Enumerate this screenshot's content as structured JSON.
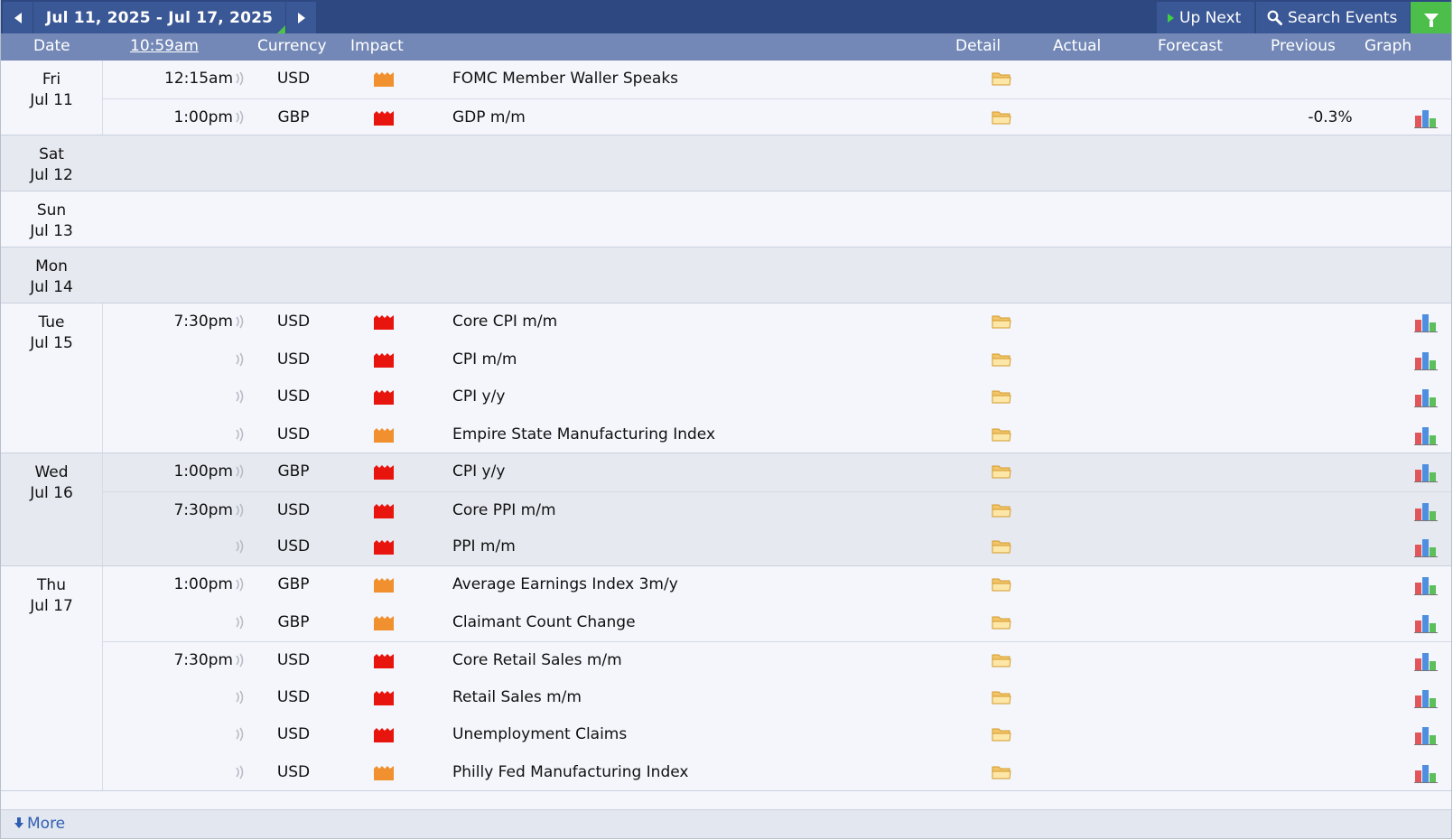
{
  "toolbar": {
    "date_range": "Jul 11, 2025 - Jul 17, 2025",
    "up_next": "Up Next",
    "search": "Search Events"
  },
  "columns": {
    "date": "Date",
    "time": "10:59am",
    "currency": "Currency",
    "impact": "Impact",
    "detail": "Detail",
    "actual": "Actual",
    "forecast": "Forecast",
    "previous": "Previous",
    "graph": "Graph"
  },
  "impact_colors": {
    "high": "#e8150e",
    "medium": "#f0902e"
  },
  "days": [
    {
      "weekday": "Fri",
      "date": "Jul 11",
      "events": [
        {
          "time": "12:15am",
          "currency": "USD",
          "impact": "medium",
          "name": "FOMC Member Waller Speaks",
          "previous": "",
          "graph": false,
          "sep": false
        },
        {
          "time": "1:00pm",
          "currency": "GBP",
          "impact": "high",
          "name": "GDP m/m",
          "previous": "-0.3%",
          "graph": true,
          "sep": true
        }
      ]
    },
    {
      "weekday": "Sat",
      "date": "Jul 12",
      "events": []
    },
    {
      "weekday": "Sun",
      "date": "Jul 13",
      "events": []
    },
    {
      "weekday": "Mon",
      "date": "Jul 14",
      "events": []
    },
    {
      "weekday": "Tue",
      "date": "Jul 15",
      "events": [
        {
          "time": "7:30pm",
          "currency": "USD",
          "impact": "high",
          "name": "Core CPI m/m",
          "previous": "",
          "graph": true,
          "sep": false
        },
        {
          "time": "",
          "currency": "USD",
          "impact": "high",
          "name": "CPI m/m",
          "previous": "",
          "graph": true,
          "sep": false
        },
        {
          "time": "",
          "currency": "USD",
          "impact": "high",
          "name": "CPI y/y",
          "previous": "",
          "graph": true,
          "sep": false
        },
        {
          "time": "",
          "currency": "USD",
          "impact": "medium",
          "name": "Empire State Manufacturing Index",
          "previous": "",
          "graph": true,
          "sep": false
        }
      ]
    },
    {
      "weekday": "Wed",
      "date": "Jul 16",
      "events": [
        {
          "time": "1:00pm",
          "currency": "GBP",
          "impact": "high",
          "name": "CPI y/y",
          "previous": "",
          "graph": true,
          "sep": false
        },
        {
          "time": "7:30pm",
          "currency": "USD",
          "impact": "high",
          "name": "Core PPI m/m",
          "previous": "",
          "graph": true,
          "sep": true
        },
        {
          "time": "",
          "currency": "USD",
          "impact": "high",
          "name": "PPI m/m",
          "previous": "",
          "graph": true,
          "sep": false
        }
      ]
    },
    {
      "weekday": "Thu",
      "date": "Jul 17",
      "events": [
        {
          "time": "1:00pm",
          "currency": "GBP",
          "impact": "medium",
          "name": "Average Earnings Index 3m/y",
          "previous": "",
          "graph": true,
          "sep": false
        },
        {
          "time": "",
          "currency": "GBP",
          "impact": "medium",
          "name": "Claimant Count Change",
          "previous": "",
          "graph": true,
          "sep": false
        },
        {
          "time": "7:30pm",
          "currency": "USD",
          "impact": "high",
          "name": "Core Retail Sales m/m",
          "previous": "",
          "graph": true,
          "sep": true
        },
        {
          "time": "",
          "currency": "USD",
          "impact": "high",
          "name": "Retail Sales m/m",
          "previous": "",
          "graph": true,
          "sep": false
        },
        {
          "time": "",
          "currency": "USD",
          "impact": "high",
          "name": "Unemployment Claims",
          "previous": "",
          "graph": true,
          "sep": false
        },
        {
          "time": "",
          "currency": "USD",
          "impact": "medium",
          "name": "Philly Fed Manufacturing Index",
          "previous": "",
          "graph": true,
          "sep": false
        }
      ]
    }
  ],
  "footer": {
    "more": "More"
  },
  "icons": {
    "prev": "chevron-left-icon",
    "next": "chevron-right-icon",
    "up_next": "play-icon",
    "search": "search-icon",
    "filter": "filter-icon",
    "sound": "sound-icon",
    "detail": "folder-icon",
    "graph": "bar-chart-icon",
    "more": "download-arrow-icon"
  }
}
